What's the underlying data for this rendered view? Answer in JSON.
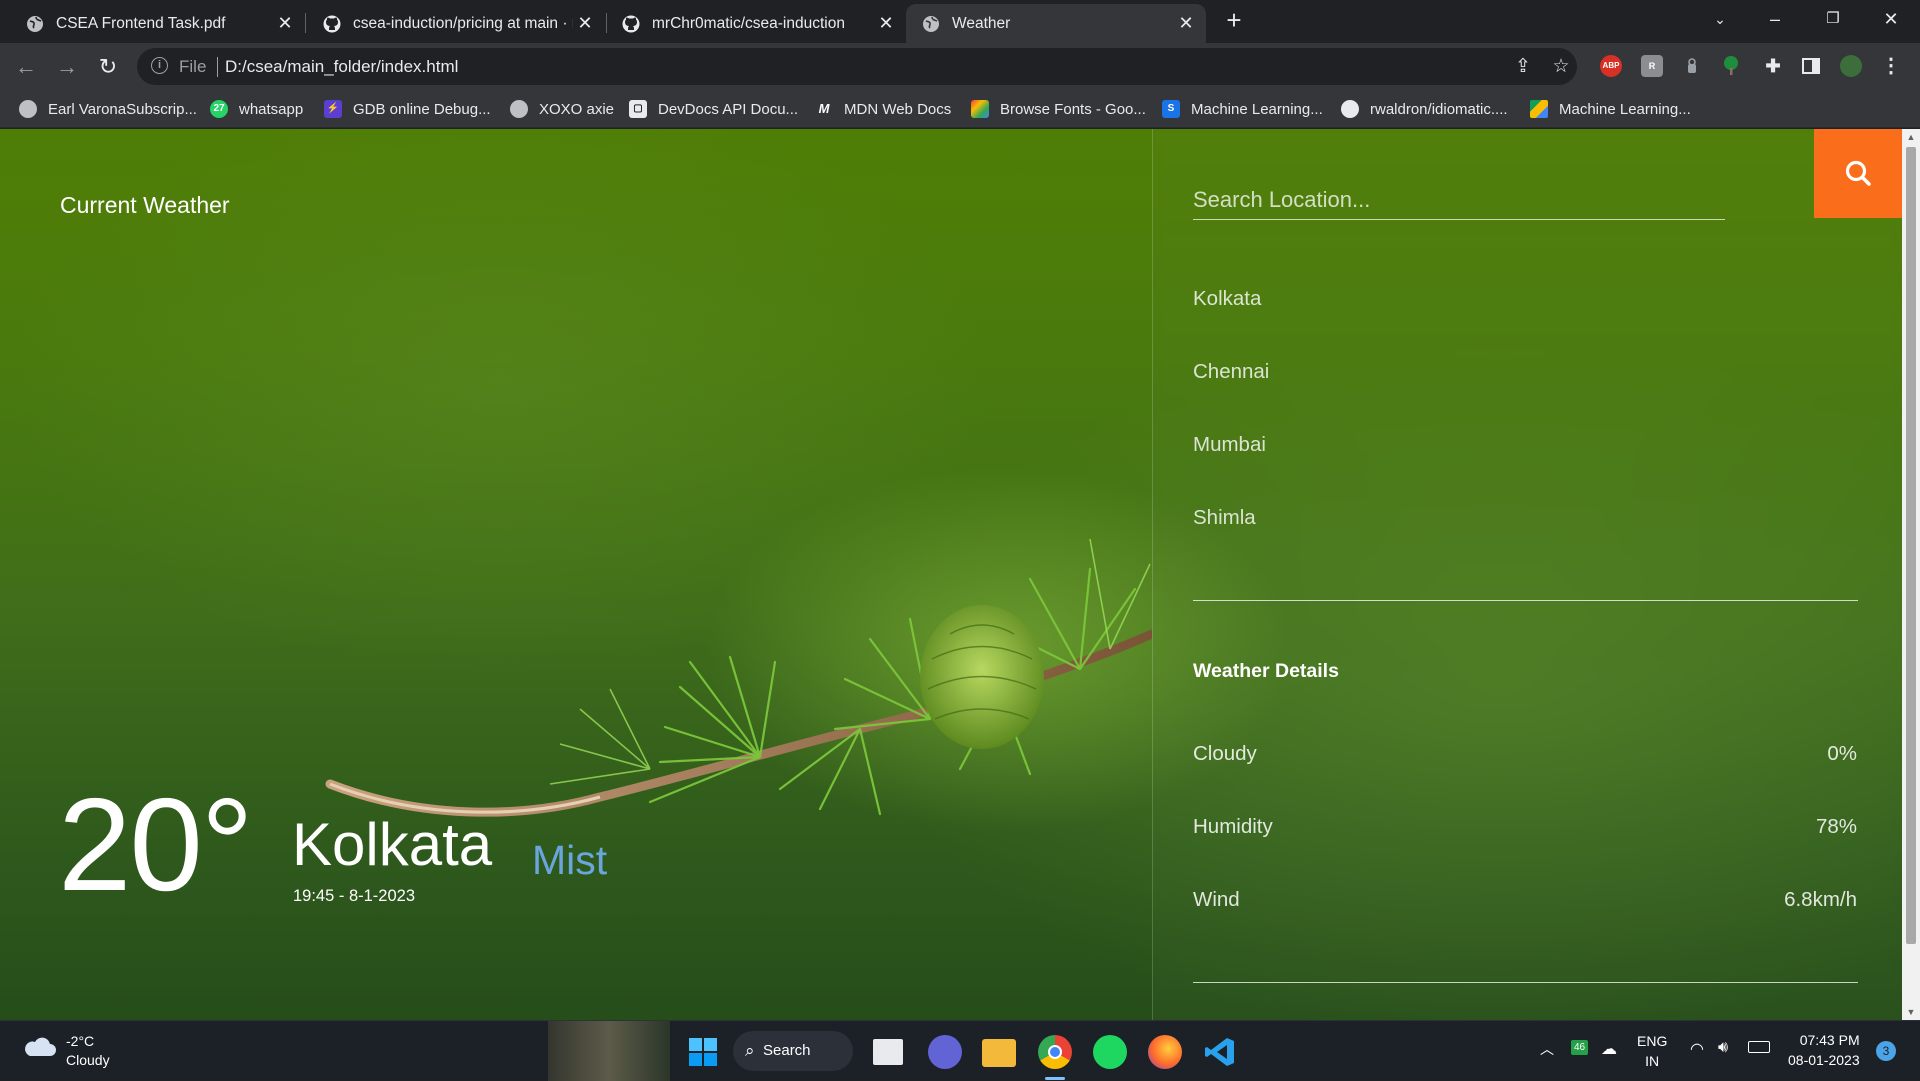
{
  "browser": {
    "tabs": [
      {
        "title": "CSEA Frontend Task.pdf",
        "icon": "globe-icon"
      },
      {
        "title": "csea-induction/pricing at main · r",
        "icon": "github-icon"
      },
      {
        "title": "mrChr0matic/csea-induction",
        "icon": "github-icon"
      },
      {
        "title": "Weather",
        "icon": "globe-icon"
      }
    ],
    "active_tab": 3,
    "address": {
      "scheme": "File",
      "url": "D:/csea/main_folder/index.html"
    },
    "extensions": [
      "ABP",
      "R",
      "tree-icon",
      "puzzle-icon",
      "avatar"
    ],
    "bookmarks": [
      {
        "label": "Earl VaronaSubscrip...",
        "icon": "globe-icon"
      },
      {
        "label": "whatsapp",
        "icon": "whatsapp-icon",
        "badge": "27"
      },
      {
        "label": "GDB online Debug...",
        "icon": "lightning-icon"
      },
      {
        "label": "XOXO axie",
        "icon": "globe-icon"
      },
      {
        "label": "DevDocs API Docu...",
        "icon": "devdocs-icon"
      },
      {
        "label": "MDN Web Docs",
        "icon": "mdn-icon"
      },
      {
        "label": "Browse Fonts - Goo...",
        "icon": "google-fonts-icon"
      },
      {
        "label": "Machine Learning...",
        "icon": "s-icon",
        "badge": "S"
      },
      {
        "label": "rwaldron/idiomatic....",
        "icon": "github-icon"
      },
      {
        "label": "Machine Learning...",
        "icon": "google-drive-icon"
      }
    ]
  },
  "app": {
    "brand": "Current Weather",
    "temperature": "20°",
    "city": "Kolkata",
    "datetime": "19:45 - 8-1-2023",
    "condition": "Mist",
    "search": {
      "placeholder": "Search Location..."
    },
    "locations": [
      "Kolkata",
      "Chennai",
      "Mumbai",
      "Shimla"
    ],
    "details_heading": "Weather Details",
    "details": [
      {
        "label": "Cloudy",
        "value": "0%"
      },
      {
        "label": "Humidity",
        "value": "78%"
      },
      {
        "label": "Wind",
        "value": "6.8km/h"
      }
    ],
    "colors": {
      "accent": "#fa6d1b",
      "condition": "#6aa6dd"
    }
  },
  "taskbar": {
    "weather_temp": "-2°C",
    "weather_text": "Cloudy",
    "search_label": "Search",
    "tray_badge": "46",
    "lang_top": "ENG",
    "lang_bottom": "IN",
    "time": "07:43 PM",
    "date": "08-01-2023",
    "notifications": "3"
  }
}
